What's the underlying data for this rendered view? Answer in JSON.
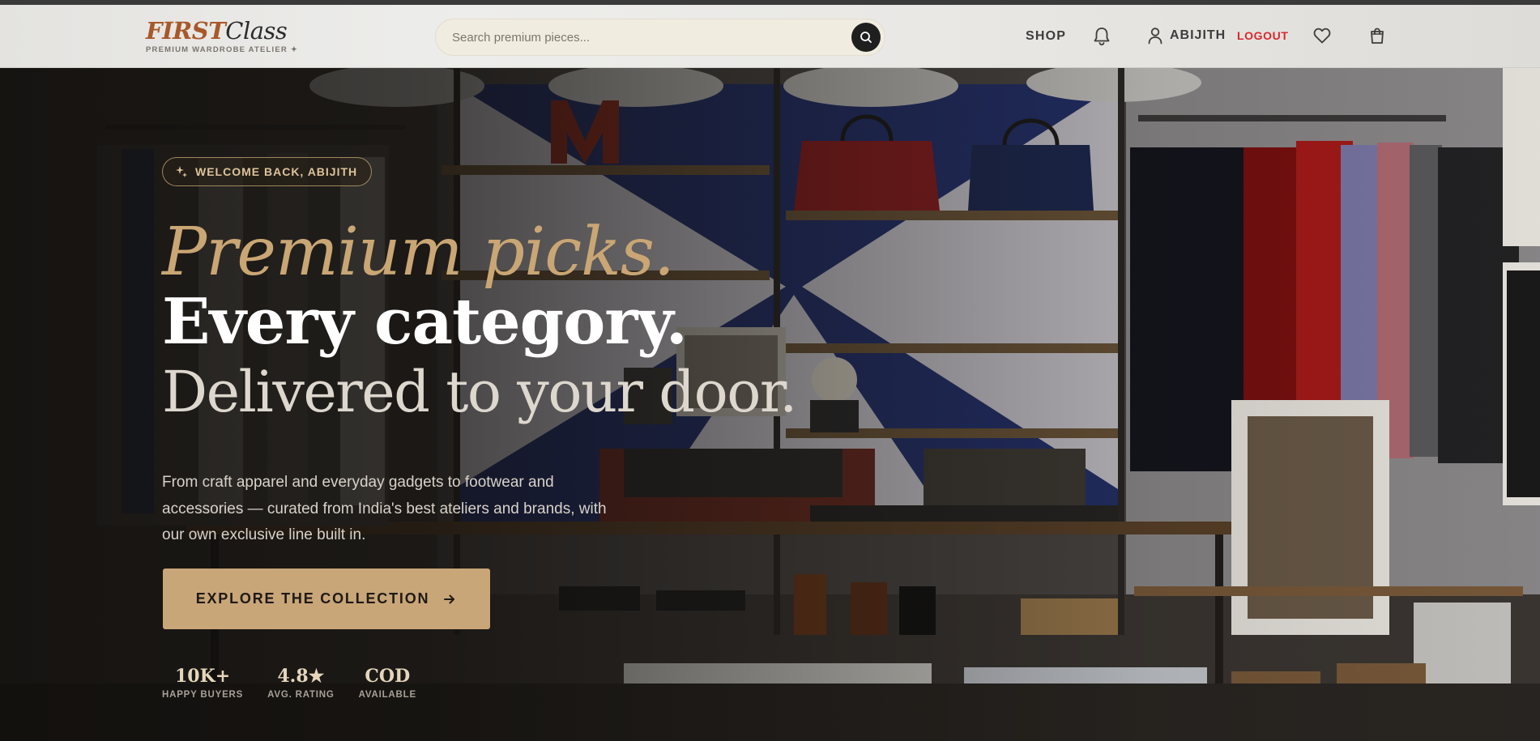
{
  "brand": {
    "name_first": "FIRST",
    "name_second": "Class",
    "tagline": "PREMIUM WARDROBE ATELIER ✦"
  },
  "search": {
    "placeholder": "Search premium pieces...",
    "icon": "search-icon"
  },
  "nav": {
    "shop_label": "SHOP",
    "notifications_icon": "bell-icon",
    "user_icon": "user-icon",
    "user_name": "ABIJITH",
    "logout_label": "LOGOUT",
    "wishlist_icon": "heart-icon",
    "cart_icon": "shopping-bag-icon"
  },
  "hero": {
    "welcome_badge": "WELCOME BACK, ABIJITH",
    "headline_line1": "Premium picks.",
    "headline_line2": "Every category.",
    "headline_line3": "Delivered to your door.",
    "description": "From craft apparel and everyday gadgets to footwear and accessories — curated from India's best ateliers and brands, with our own exclusive line built in.",
    "cta_label": "EXPLORE THE COLLECTION",
    "stats": [
      {
        "value": "10K+",
        "label": "HAPPY BUYERS"
      },
      {
        "value": "4.8★",
        "label": "AVG. RATING"
      },
      {
        "value": "COD",
        "label": "AVAILABLE"
      }
    ]
  },
  "colors": {
    "brand_accent": "#a8582a",
    "gold": "#c9a678",
    "logout_red": "#d6282f",
    "header_bg": "#e8e7e4",
    "search_bg": "#f1ece0"
  }
}
